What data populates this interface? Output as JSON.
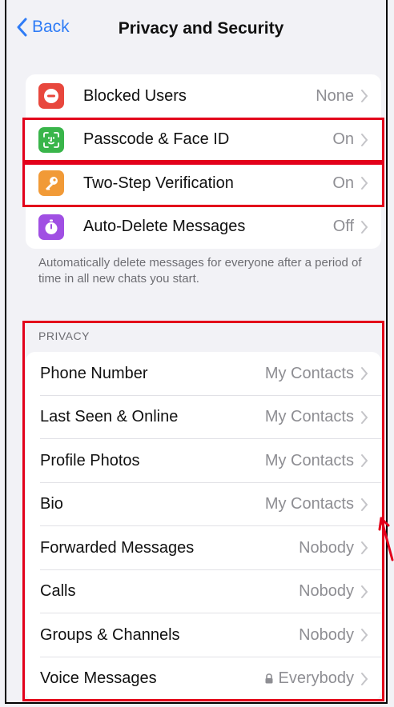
{
  "nav": {
    "back_label": "Back",
    "title": "Privacy and Security"
  },
  "security_items": [
    {
      "label": "Blocked Users",
      "value": "None",
      "icon": "minus-circle-icon",
      "color": "#e8473d"
    },
    {
      "label": "Passcode & Face ID",
      "value": "On",
      "icon": "face-id-icon",
      "color": "#39b54a"
    },
    {
      "label": "Two-Step Verification",
      "value": "On",
      "icon": "key-icon",
      "color": "#f19a37"
    },
    {
      "label": "Auto-Delete Messages",
      "value": "Off",
      "icon": "timer-icon",
      "color": "#a04fe3"
    }
  ],
  "auto_delete_note": "Automatically delete messages for everyone after a period of time in all new chats you start.",
  "privacy": {
    "header": "PRIVACY",
    "items": [
      {
        "label": "Phone Number",
        "value": "My Contacts"
      },
      {
        "label": "Last Seen & Online",
        "value": "My Contacts"
      },
      {
        "label": "Profile Photos",
        "value": "My Contacts"
      },
      {
        "label": "Bio",
        "value": "My Contacts"
      },
      {
        "label": "Forwarded Messages",
        "value": "Nobody"
      },
      {
        "label": "Calls",
        "value": "Nobody"
      },
      {
        "label": "Groups & Channels",
        "value": "Nobody"
      },
      {
        "label": "Voice Messages",
        "value": "Everybody",
        "locked": true
      }
    ]
  },
  "colors": {
    "accent": "#2f7cf6",
    "highlight_box": "#e3001b"
  }
}
